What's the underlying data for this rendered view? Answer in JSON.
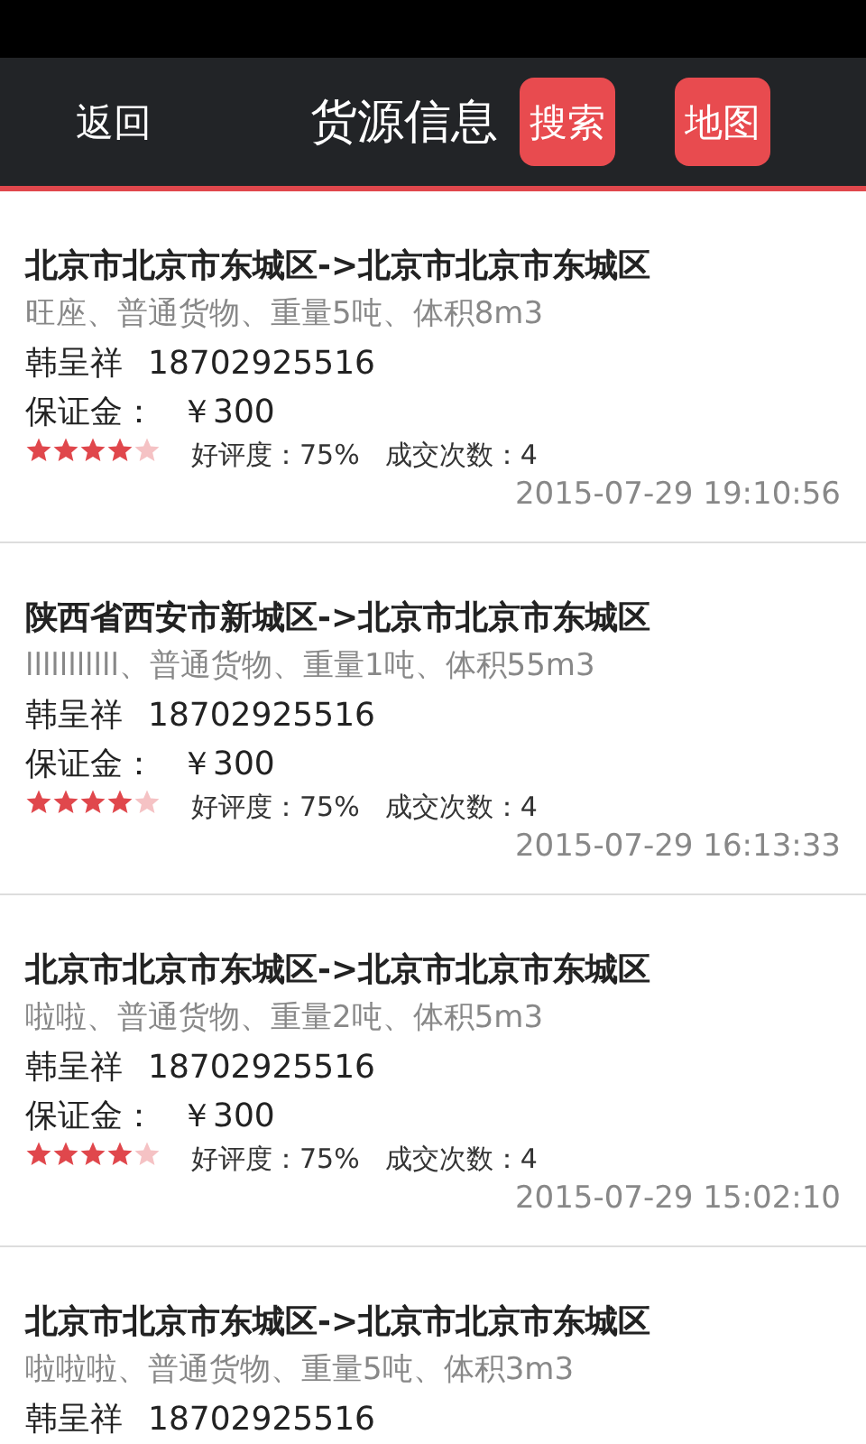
{
  "nav": {
    "back": "返回",
    "title": "货源信息",
    "search": "搜索",
    "map": "地图"
  },
  "items": [
    {
      "route": "北京市北京市东城区->北京市北京市东城区",
      "desc": "旺座、普通货物、重量5吨、体积8m3",
      "name": "韩呈祥",
      "phone": "18702925516",
      "deposit_label": "保证金：",
      "deposit": "￥300",
      "stars": 4,
      "rating": "好评度：75%",
      "deals": "成交次数：4",
      "time": "2015-07-29 19:10:56"
    },
    {
      "route": "陕西省西安市新城区->北京市北京市东城区",
      "desc": "lllllllllll、普通货物、重量1吨、体积55m3",
      "name": "韩呈祥",
      "phone": "18702925516",
      "deposit_label": "保证金：",
      "deposit": "￥300",
      "stars": 4,
      "rating": "好评度：75%",
      "deals": "成交次数：4",
      "time": "2015-07-29 16:13:33"
    },
    {
      "route": "北京市北京市东城区->北京市北京市东城区",
      "desc": "啦啦、普通货物、重量2吨、体积5m3",
      "name": "韩呈祥",
      "phone": "18702925516",
      "deposit_label": "保证金：",
      "deposit": "￥300",
      "stars": 4,
      "rating": "好评度：75%",
      "deals": "成交次数：4",
      "time": "2015-07-29 15:02:10"
    },
    {
      "route": "北京市北京市东城区->北京市北京市东城区",
      "desc": "啦啦啦、普通货物、重量5吨、体积3m3",
      "name": "韩呈祥",
      "phone": "18702925516"
    }
  ]
}
